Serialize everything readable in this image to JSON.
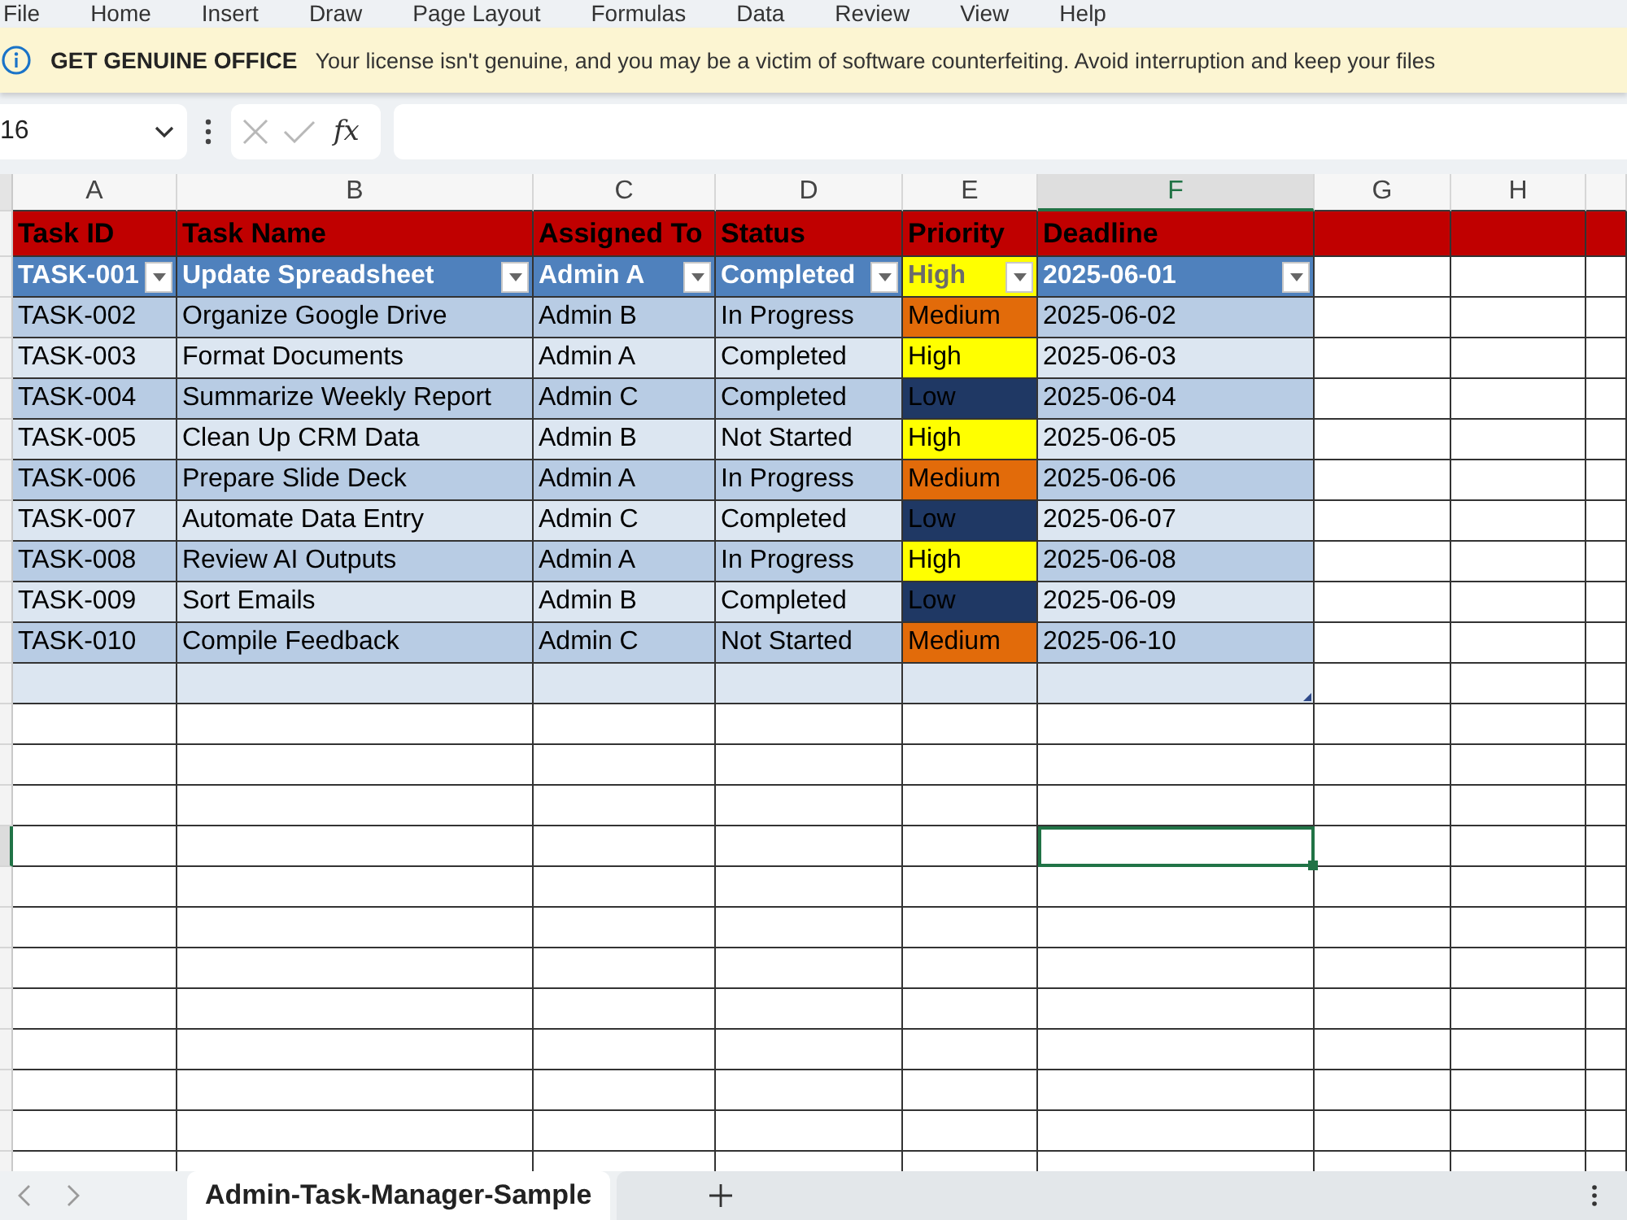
{
  "menu": [
    "File",
    "Home",
    "Insert",
    "Draw",
    "Page Layout",
    "Formulas",
    "Data",
    "Review",
    "View",
    "Help"
  ],
  "banner": {
    "title": "GET GENUINE OFFICE",
    "message": "Your license isn't genuine, and you may be a victim of software counterfeiting. Avoid interruption and keep your files"
  },
  "formula_bar": {
    "name_box": "16",
    "function_label": "fx"
  },
  "columns": [
    {
      "letter": "A",
      "selected": false
    },
    {
      "letter": "B",
      "selected": false
    },
    {
      "letter": "C",
      "selected": false
    },
    {
      "letter": "D",
      "selected": false
    },
    {
      "letter": "E",
      "selected": false
    },
    {
      "letter": "F",
      "selected": true
    },
    {
      "letter": "G",
      "selected": false
    },
    {
      "letter": "H",
      "selected": false
    }
  ],
  "table": {
    "headers": [
      "Task ID",
      "Task Name",
      "Assigned To",
      "Status",
      "Priority",
      "Deadline"
    ],
    "filter_row": {
      "task_id": "TASK-001",
      "task_name": "Update Spreadsheet",
      "assigned_to": "Admin A",
      "status": "Completed",
      "priority": {
        "text": "High",
        "color": "#ffff00"
      },
      "deadline": "2025-06-01"
    },
    "rows": [
      {
        "task_id": "TASK-002",
        "task_name": "Organize Google Drive",
        "assigned_to": "Admin B",
        "status": "In Progress",
        "priority": {
          "text": "Medium",
          "color": "#e26b0a"
        },
        "deadline": "2025-06-02"
      },
      {
        "task_id": "TASK-003",
        "task_name": "Format Documents",
        "assigned_to": "Admin A",
        "status": "Completed",
        "priority": {
          "text": "High",
          "color": "#ffff00"
        },
        "deadline": "2025-06-03"
      },
      {
        "task_id": "TASK-004",
        "task_name": "Summarize Weekly Report",
        "assigned_to": "Admin C",
        "status": "Completed",
        "priority": {
          "text": "Low",
          "color": "#1f3864"
        },
        "deadline": "2025-06-04"
      },
      {
        "task_id": "TASK-005",
        "task_name": "Clean Up CRM Data",
        "assigned_to": "Admin B",
        "status": "Not Started",
        "priority": {
          "text": "High",
          "color": "#ffff00"
        },
        "deadline": "2025-06-05"
      },
      {
        "task_id": "TASK-006",
        "task_name": "Prepare Slide Deck",
        "assigned_to": "Admin A",
        "status": "In Progress",
        "priority": {
          "text": "Medium",
          "color": "#e26b0a"
        },
        "deadline": "2025-06-06"
      },
      {
        "task_id": "TASK-007",
        "task_name": "Automate Data Entry",
        "assigned_to": "Admin C",
        "status": "Completed",
        "priority": {
          "text": "Low",
          "color": "#1f3864"
        },
        "deadline": "2025-06-07"
      },
      {
        "task_id": "TASK-008",
        "task_name": "Review AI Outputs",
        "assigned_to": "Admin A",
        "status": "In Progress",
        "priority": {
          "text": "High",
          "color": "#ffff00"
        },
        "deadline": "2025-06-08"
      },
      {
        "task_id": "TASK-009",
        "task_name": "Sort Emails",
        "assigned_to": "Admin B",
        "status": "Completed",
        "priority": {
          "text": "Low",
          "color": "#1f3864"
        },
        "deadline": "2025-06-09"
      },
      {
        "task_id": "TASK-010",
        "task_name": "Compile Feedback",
        "assigned_to": "Admin C",
        "status": "Not Started",
        "priority": {
          "text": "Medium",
          "color": "#e26b0a"
        },
        "deadline": "2025-06-10"
      }
    ]
  },
  "empty_rows": [
    {
      "kind": "table",
      "selected": false
    },
    {
      "kind": "sheet",
      "selected": false
    },
    {
      "kind": "sheet",
      "selected": false
    },
    {
      "kind": "sheet",
      "selected": false
    },
    {
      "kind": "sheet",
      "selected": true
    },
    {
      "kind": "sheet",
      "selected": false
    },
    {
      "kind": "sheet",
      "selected": false
    },
    {
      "kind": "sheet",
      "selected": false
    },
    {
      "kind": "sheet",
      "selected": false
    },
    {
      "kind": "sheet",
      "selected": false
    },
    {
      "kind": "sheet",
      "selected": false
    },
    {
      "kind": "sheet",
      "selected": false
    },
    {
      "kind": "sheet",
      "selected": false
    }
  ],
  "sheet_tabs": [
    {
      "label": "Admin-Task-Manager-Sample",
      "selected": true
    }
  ]
}
